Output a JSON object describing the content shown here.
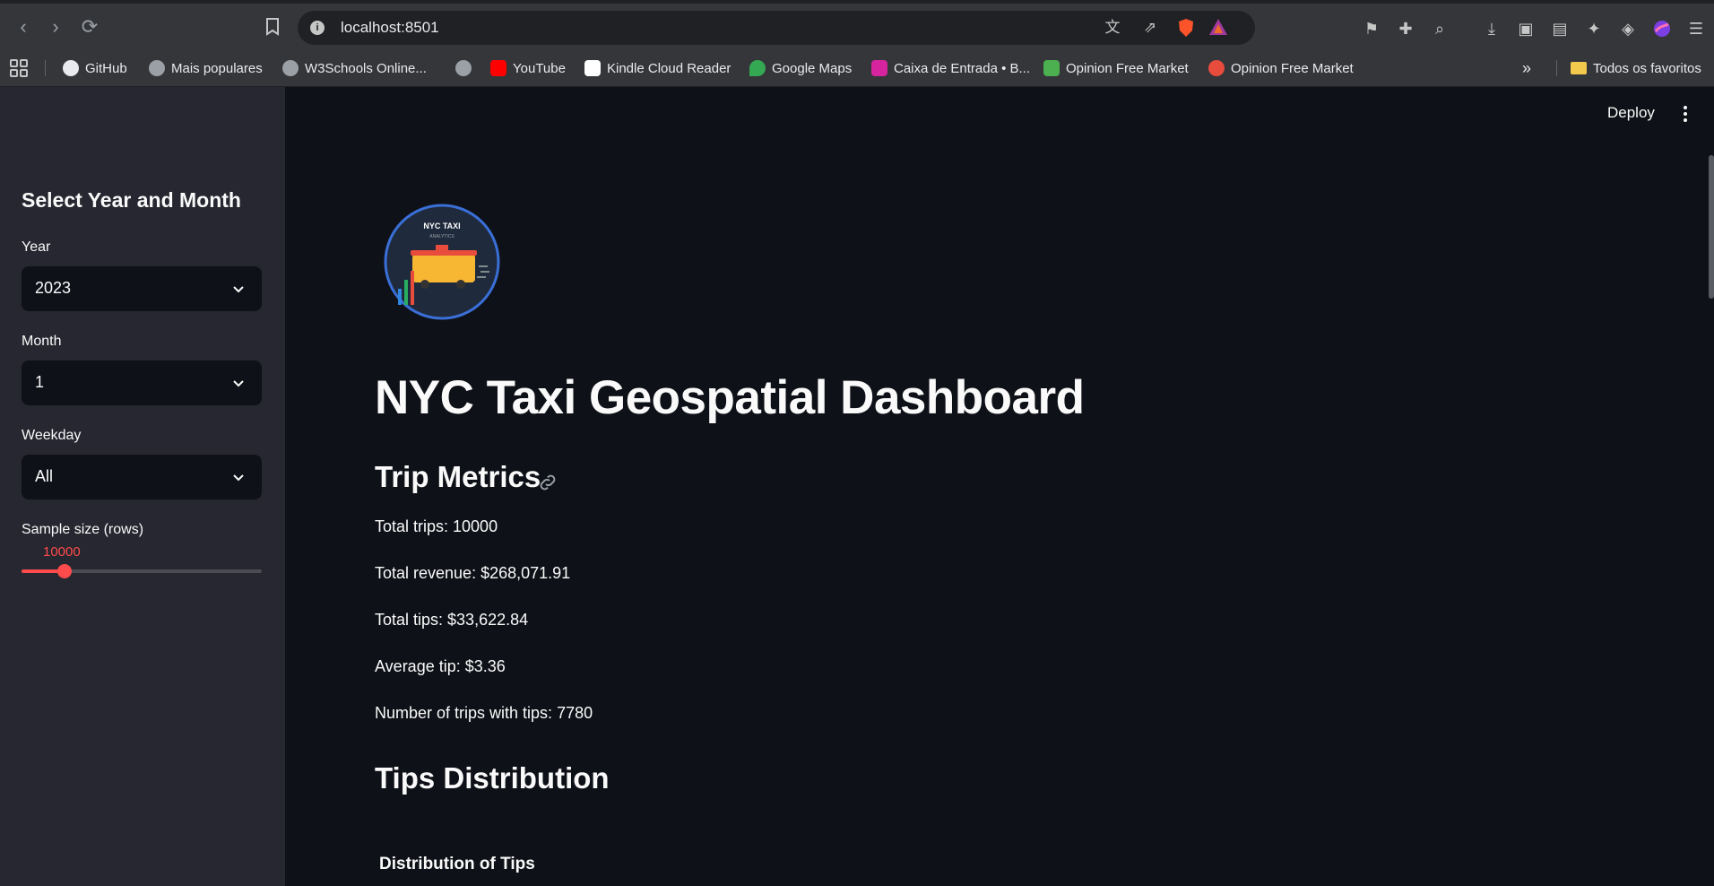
{
  "browser": {
    "url": "localhost:8501",
    "info_glyph": "i"
  },
  "bookmarks": {
    "items": [
      {
        "label": "GitHub",
        "icon": "github-icon",
        "color": "#e8eaed"
      },
      {
        "label": "Mais populares",
        "icon": "globe-icon",
        "color": "#9aa0a6"
      },
      {
        "label": "W3Schools Online...",
        "icon": "globe-icon",
        "color": "#9aa0a6"
      },
      {
        "label": "",
        "icon": "globe-icon",
        "color": "#9aa0a6"
      },
      {
        "label": "YouTube",
        "icon": "youtube-icon",
        "color": "#ff0000"
      },
      {
        "label": "Kindle Cloud Reader",
        "icon": "kindle-icon",
        "color": "#ffffff"
      },
      {
        "label": "Google Maps",
        "icon": "maps-icon",
        "color": "#34a853"
      },
      {
        "label": "Caixa de Entrada • B...",
        "icon": "instagram-icon",
        "color": "#d6249f"
      },
      {
        "label": "Opinion Free Market",
        "icon": "play-icon",
        "color": "#4caf50"
      },
      {
        "label": "Opinion Free Market",
        "icon": "opinion-icon",
        "color": "#e74c3c"
      }
    ],
    "more": "»",
    "all_bookmarks": "Todos os favoritos"
  },
  "sidebar": {
    "title": "Select Year and Month",
    "year_label": "Year",
    "year_value": "2023",
    "month_label": "Month",
    "month_value": "1",
    "weekday_label": "Weekday",
    "weekday_value": "All",
    "sample_label": "Sample size (rows)",
    "sample_value": "10000",
    "sample_fraction": 0.18
  },
  "header": {
    "deploy": "Deploy"
  },
  "logo": {
    "title": "NYC TAXI",
    "subtitle": "ANALYTICS"
  },
  "main": {
    "title": "NYC Taxi Geospatial Dashboard",
    "trip_metrics_heading": "Trip Metrics",
    "metrics": [
      "Total trips: 10000",
      "Total revenue: $268,071.91",
      "Total tips: $33,622.84",
      "Average tip: $3.36",
      "Number of trips with tips: 7780"
    ],
    "tips_heading": "Tips Distribution",
    "tips_subheading": "Distribution of Tips"
  },
  "colors": {
    "accent": "#ff4b4b",
    "background": "#0e1117",
    "sidebar": "#262730"
  }
}
